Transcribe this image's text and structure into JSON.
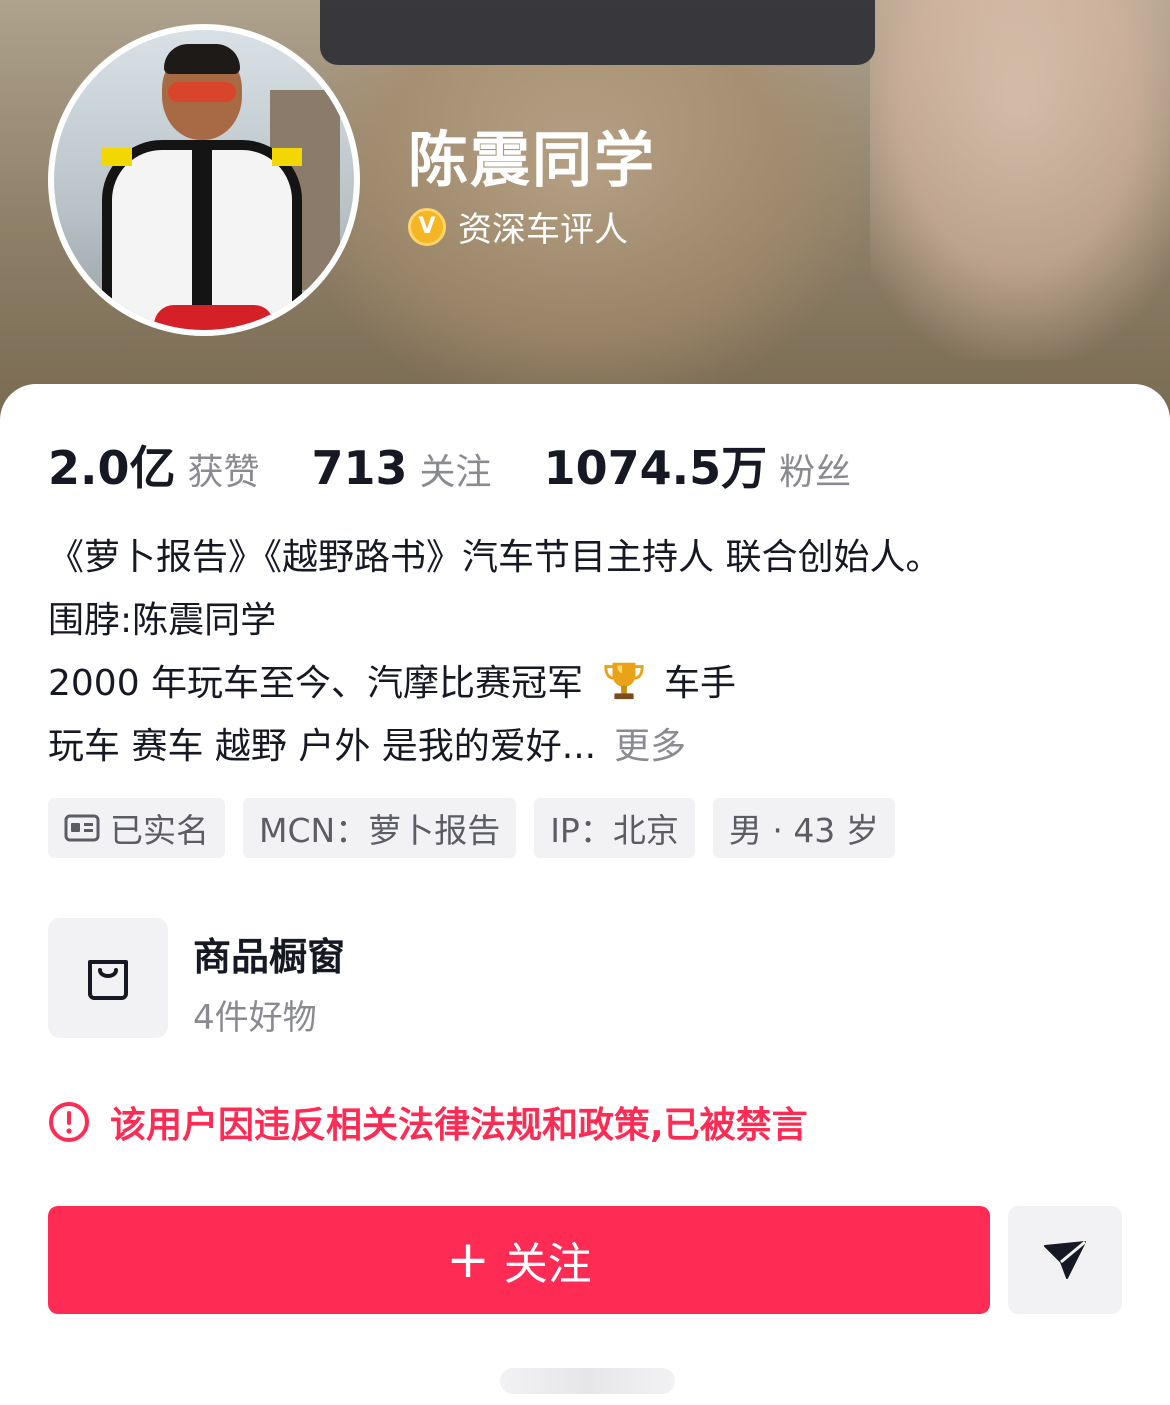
{
  "profile": {
    "name": "陈震同学",
    "verification": "资深车评人",
    "verify_badge": "V"
  },
  "stats": [
    {
      "value": "2.0亿",
      "label": "获赞"
    },
    {
      "value": "713",
      "label": "关注"
    },
    {
      "value": "1074.5万",
      "label": "粉丝"
    }
  ],
  "bio": {
    "line1": "《萝卜报告》《越野路书》汽车节目主持人 联合创始人。",
    "line2": "围脖:陈震同学",
    "line3_before": "2000 年玩车至今、汽摩比赛冠军",
    "line3_after": "车手",
    "line4": "玩车 赛车 越野 户外 是我的爱好...",
    "more": "更多"
  },
  "tags": {
    "realname": "已实名",
    "mcn": "MCN：萝卜报告",
    "ip": "IP：北京",
    "gender_age": "男 · 43 岁"
  },
  "shop": {
    "title": "商品橱窗",
    "subtitle": "4件好物"
  },
  "warning": "该用户因违反相关法律法规和政策,已被禁言",
  "actions": {
    "follow_plus": "+",
    "follow_label": "关注"
  },
  "colors": {
    "accent": "#fe2c55",
    "verify": "#f5b623",
    "muted_text": "#8a8b91",
    "tag_bg": "#f2f2f4"
  }
}
